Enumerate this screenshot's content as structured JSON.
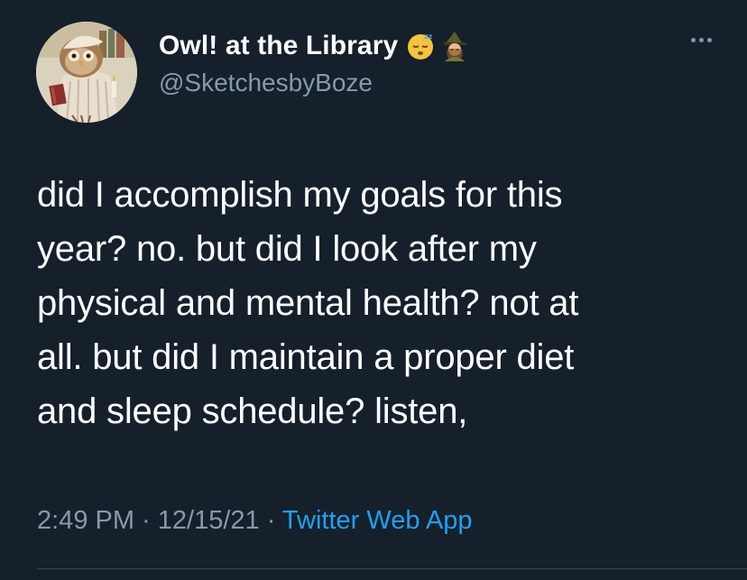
{
  "author": {
    "display_name": "Owl! at the Library",
    "handle": "@SketchesbyBoze",
    "avatar": "owl-librarian-illustration",
    "emojis": [
      "sleeping-face-emoji",
      "witch-emoji"
    ]
  },
  "tweet": {
    "lines": [
      "did I accomplish my goals for this",
      "year? no. but did I look after my",
      "physical and mental health? not at",
      "all. but did I maintain a proper diet",
      "and sleep schedule? listen,"
    ]
  },
  "meta": {
    "time": "2:49 PM",
    "separator": " · ",
    "date": "12/15/21",
    "source": "Twitter Web App"
  },
  "colors": {
    "background": "#15202b",
    "text": "#ffffff",
    "secondary": "#8899a6",
    "link": "#1da1f2"
  },
  "icons": {
    "more": "more-horizontal-icon"
  }
}
